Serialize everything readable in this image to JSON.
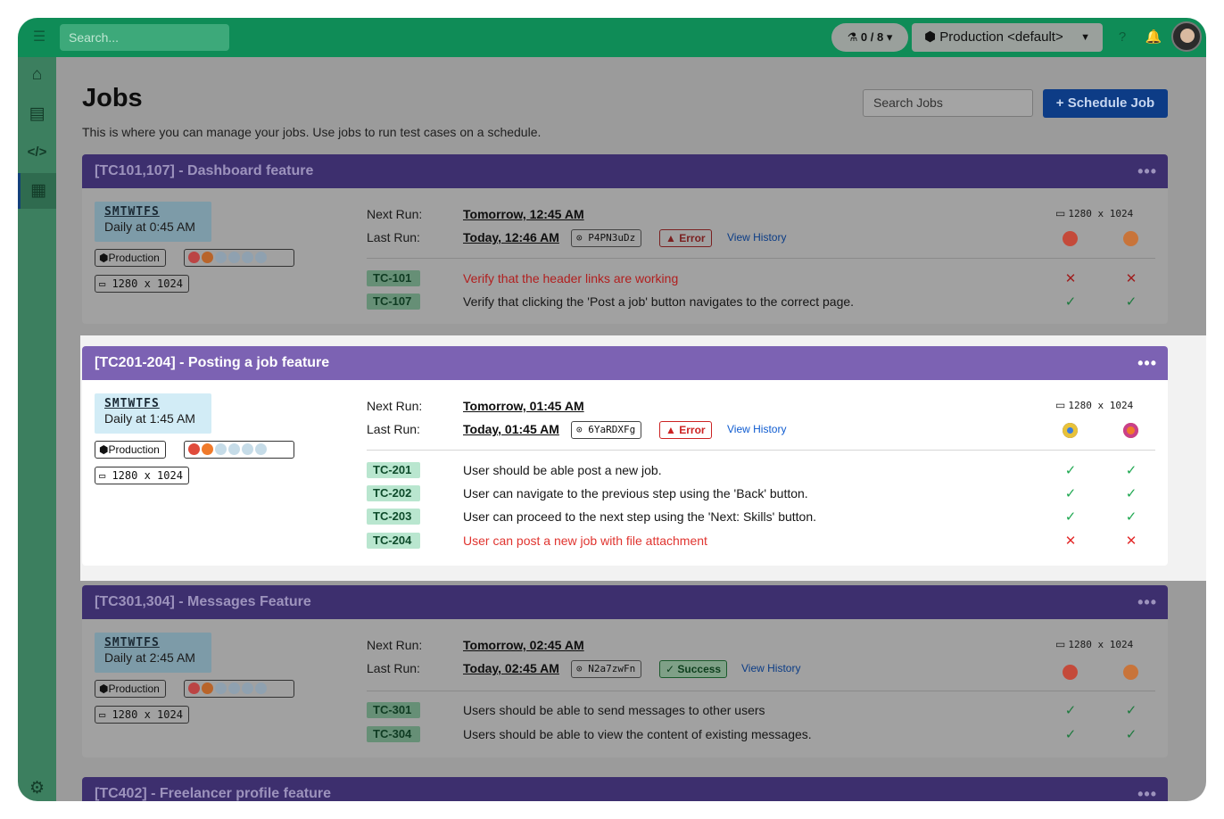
{
  "topbar": {
    "search_placeholder": "Search...",
    "runs_pill": "0 / 8 ▾",
    "environment": "Production <default>",
    "menu_icon": "hamburger-icon",
    "help_icon": "help-icon",
    "bell_icon": "bell-icon"
  },
  "sidebar": {
    "items": [
      {
        "name": "home-icon",
        "glyph": "⌂"
      },
      {
        "name": "clipboard-icon",
        "glyph": "📋"
      },
      {
        "name": "code-icon",
        "glyph": "</>"
      },
      {
        "name": "calendar-icon",
        "glyph": "▦"
      },
      {
        "name": "settings-icon",
        "glyph": "⚙"
      }
    ]
  },
  "page": {
    "title": "Jobs",
    "description": "This is where you can manage your jobs. Use jobs to run test cases on a schedule.",
    "search_placeholder": "Search Jobs",
    "schedule_button": "+ Schedule Job"
  },
  "labels": {
    "next_run": "Next Run:",
    "last_run": "Last Run:",
    "view_history": "View History",
    "more": "•••",
    "resolution": "1280 x 1024",
    "environment_badge": "Production",
    "days": "SMTWTFS"
  },
  "jobs": [
    {
      "title": "[TC101,107] - Dashboard feature",
      "schedule": "Daily at 0:45 AM",
      "next_run": "Tomorrow, 12:45 AM",
      "last_run": "Today, 12:46 AM",
      "run_id": "P4PN3uDz",
      "status": "Error",
      "tests": [
        {
          "id": "TC-101",
          "desc": "Verify that the header links are working",
          "chrome": "fail",
          "firefox": "fail"
        },
        {
          "id": "TC-107",
          "desc": "Verify that clicking the 'Post a job' button navigates to the correct page.",
          "chrome": "pass",
          "firefox": "pass"
        }
      ]
    },
    {
      "title": "[TC201-204] - Posting a job feature",
      "schedule": "Daily at 1:45 AM",
      "next_run": "Tomorrow, 01:45 AM",
      "last_run": "Today, 01:45 AM",
      "run_id": "6YaRDXFg",
      "status": "Error",
      "tests": [
        {
          "id": "TC-201",
          "desc": "User should be able post a new job.",
          "chrome": "pass",
          "firefox": "pass"
        },
        {
          "id": "TC-202",
          "desc": "User can navigate to the previous step using the 'Back' button.",
          "chrome": "pass",
          "firefox": "pass"
        },
        {
          "id": "TC-203",
          "desc": "User can proceed to the next step using the 'Next: Skills' button.",
          "chrome": "pass",
          "firefox": "pass"
        },
        {
          "id": "TC-204",
          "desc": "User can post a new job with file attachment",
          "chrome": "fail",
          "firefox": "fail"
        }
      ]
    },
    {
      "title": "[TC301,304] - Messages Feature",
      "schedule": "Daily at 2:45 AM",
      "next_run": "Tomorrow, 02:45 AM",
      "last_run": "Today, 02:45 AM",
      "run_id": "N2a7zwFn",
      "status": "Success",
      "tests": [
        {
          "id": "TC-301",
          "desc": "Users should be able to send messages to other users",
          "chrome": "pass",
          "firefox": "pass"
        },
        {
          "id": "TC-304",
          "desc": "Users should be able to view the content of existing messages.",
          "chrome": "pass",
          "firefox": "pass"
        }
      ]
    },
    {
      "title": "[TC402] - Freelancer profile feature"
    }
  ],
  "colors": {
    "topbar": "#0f8c57",
    "card_header": "#7c62b3",
    "primary_button": "#0d3c86",
    "error": "#e0342f",
    "success": "#1fa851"
  }
}
